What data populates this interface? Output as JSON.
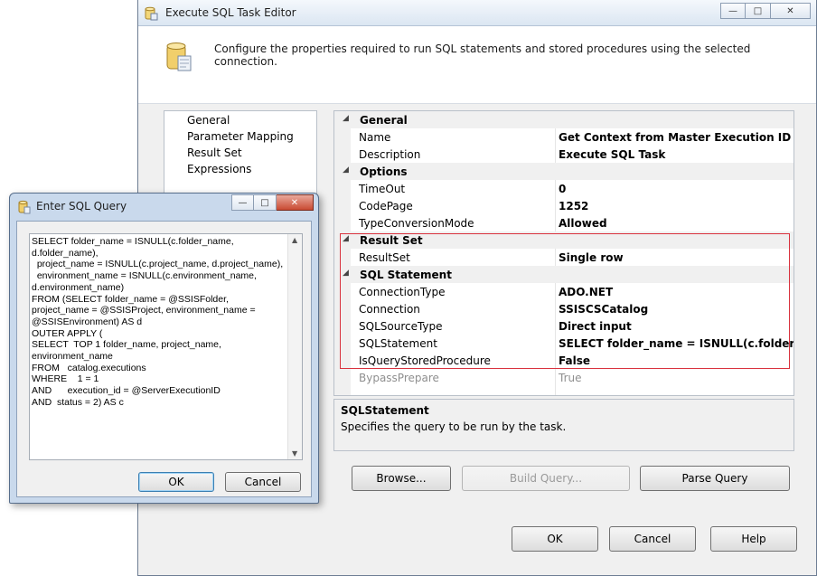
{
  "main_window": {
    "title": "Execute SQL Task Editor",
    "header_text": "Configure the properties required to run SQL statements and stored procedures using the selected connection."
  },
  "nav": {
    "items": [
      "General",
      "Parameter Mapping",
      "Result Set",
      "Expressions"
    ]
  },
  "properties": {
    "cat_general": "General",
    "name_label": "Name",
    "name_value": "Get Context from Master Execution ID",
    "description_label": "Description",
    "description_value": "Execute SQL Task",
    "cat_options": "Options",
    "timeout_label": "TimeOut",
    "timeout_value": "0",
    "codepage_label": "CodePage",
    "codepage_value": "1252",
    "typeconv_label": "TypeConversionMode",
    "typeconv_value": "Allowed",
    "cat_resultset": "Result Set",
    "resultset_label": "ResultSet",
    "resultset_value": "Single row",
    "cat_sqlstatement": "SQL Statement",
    "conntype_label": "ConnectionType",
    "conntype_value": "ADO.NET",
    "connection_label": "Connection",
    "connection_value": "SSISCSCatalog",
    "sqlsourcetype_label": "SQLSourceType",
    "sqlsourcetype_value": "Direct input",
    "sqlstatement_label": "SQLStatement",
    "sqlstatement_value": "SELECT folder_name = ISNULL(c.folder_name, d",
    "isquerysp_label": "IsQueryStoredProcedure",
    "isquerysp_value": "False",
    "bypass_label": "BypassPrepare",
    "bypass_value": "True"
  },
  "description_panel": {
    "title": "SQLStatement",
    "text": "Specifies the query to be run by the task."
  },
  "buttons": {
    "browse": "Browse...",
    "build_query": "Build Query...",
    "parse_query": "Parse Query",
    "ok": "OK",
    "cancel": "Cancel",
    "help": "Help"
  },
  "popup": {
    "title": "Enter SQL Query",
    "sql": "SELECT folder_name = ISNULL(c.folder_name, d.folder_name),\n  project_name = ISNULL(c.project_name, d.project_name),\n  environment_name = ISNULL(c.environment_name, d.environment_name)\nFROM (SELECT folder_name = @SSISFolder, project_name = @SSISProject, environment_name = @SSISEnvironment) AS d\nOUTER APPLY (\nSELECT  TOP 1 folder_name, project_name, environment_name\nFROM   catalog.executions\nWHERE    1 = 1\nAND      execution_id = @ServerExecutionID\nAND  status = 2) AS c",
    "ok": "OK",
    "cancel": "Cancel"
  },
  "colors": {
    "highlight_border": "#d9333f",
    "window_bg": "#f0f0f0"
  }
}
